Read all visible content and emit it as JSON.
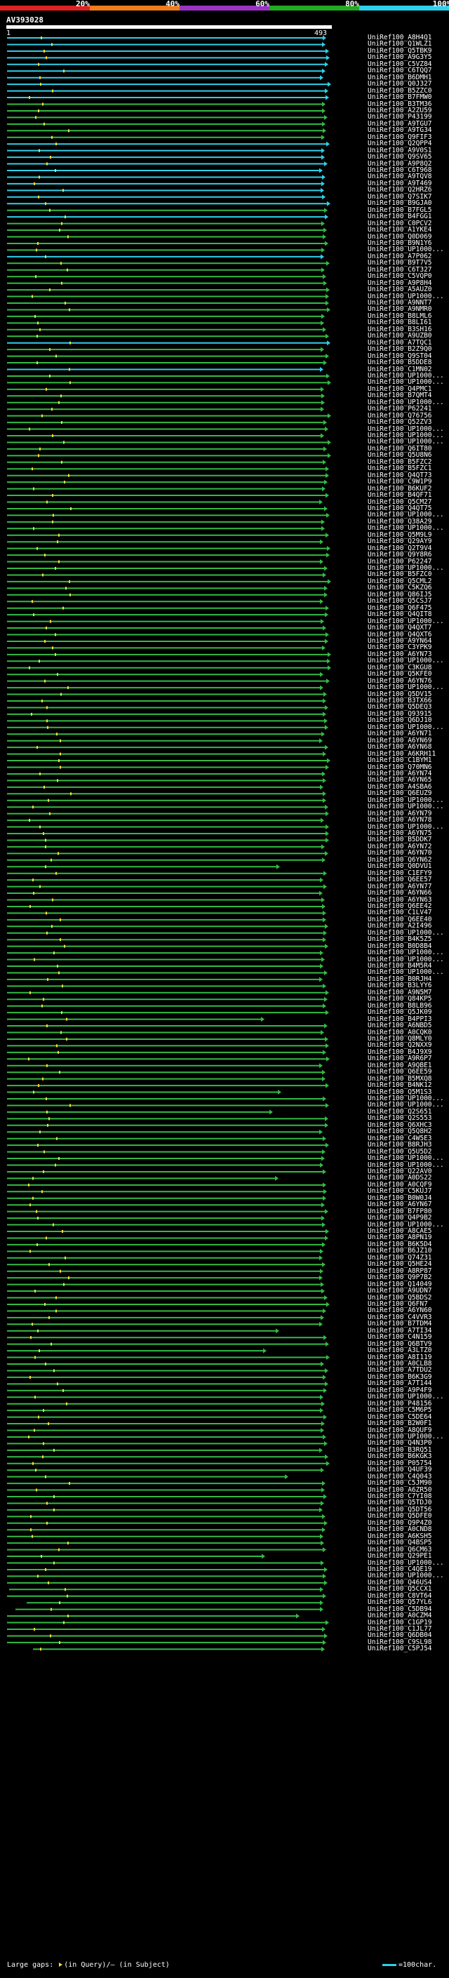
{
  "query": {
    "id": "AV393028",
    "start": "1",
    "end": "493"
  },
  "identity_scale": [
    {
      "label": "20%",
      "color": "#dd2222"
    },
    {
      "label": "40%",
      "color": "#f07c1c"
    },
    {
      "label": "60%",
      "color": "#9b34c4"
    },
    {
      "label": "80%",
      "color": "#22aa22"
    },
    {
      "label": "100%",
      "color": "#2ed0ea"
    }
  ],
  "legend": {
    "text": "Large gaps: ",
    "in_query": "(in Query)",
    "in_subject": "/— (in Subject)",
    "scale": "=100char."
  },
  "hit_colors": {
    "high": "#2ed0ea",
    "mid": "#33bb44",
    "low": "#1e7a2a"
  },
  "hits": [
    "UniRef100_A8H4Q1",
    "UniRef100_Q1WLZ1",
    "UniRef100_Q5TBK9",
    "UniRef100_A9G3Y5",
    "UniRef100_C5VZ84",
    "UniRef100_C6TQQ7",
    "UniRef100_B6DMH1",
    "UniRef100_Q0J327",
    "UniRef100_B5ZZC0",
    "UniRef100_B7FMW0",
    "UniRef100_B3TM36",
    "UniRef100_A2ZU59",
    "UniRef100_P43199",
    "UniRef100_A9TGU7",
    "UniRef100_A9TG34",
    "UniRef100_Q9FIF3",
    "UniRef100_Q2QPP4",
    "UniRef100_A9V0S1",
    "UniRef100_Q9SV65",
    "UniRef100_A9P8Q2",
    "UniRef100_C6T968",
    "UniRef100_A9TQV8",
    "UniRef100_A9T469",
    "UniRef100_Q2HRZ6",
    "UniRef100_Q7SIK7",
    "UniRef100_B9GJA0",
    "UniRef100_B7FGL5",
    "UniRef100_B4FGG1",
    "UniRef100_C0PCV2",
    "UniRef100_A1YKE4",
    "UniRef100_Q0D069",
    "UniRef100_B9N1Y6",
    "UniRef100_UP1000...",
    "UniRef100_A7P062",
    "UniRef100_B9T7V5",
    "UniRef100_C6T327",
    "UniRef100_C5VQP0",
    "UniRef100_A9P8H4",
    "UniRef100_A5AUZ0",
    "UniRef100_UP1000...",
    "UniRef100_A9NNT7",
    "UniRef100_A9NMR0",
    "UniRef100_B8LML6",
    "UniRef100_B8LI61",
    "UniRef100_B3SH16",
    "UniRef100_A9UZB0",
    "UniRef100_A7TQC1",
    "UniRef100_B2Z9Q0",
    "UniRef100_Q9ST04",
    "UniRef100_B5DDE8",
    "UniRef100_C1MN02",
    "UniRef100_UP1000...",
    "UniRef100_UP1000...",
    "UniRef100_Q4PMC1",
    "UniRef100_B7QMT4",
    "UniRef100_UP1000...",
    "UniRef100_P62241",
    "UniRef100_Q76756",
    "UniRef100_Q52ZV3",
    "UniRef100_UP1000...",
    "UniRef100_UP1000...",
    "UniRef100_UP1000...",
    "UniRef100_Q6IT80",
    "UniRef100_Q5U8N6",
    "UniRef100_B5FZC2",
    "UniRef100_B5FZC1",
    "UniRef100_Q4QT73",
    "UniRef100_C9W1P9",
    "UniRef100_B6KUF2",
    "UniRef100_B4QF71",
    "UniRef100_Q5CM27",
    "UniRef100_Q4QT75",
    "UniRef100_UP1000...",
    "UniRef100_Q38A29",
    "UniRef100_UP1000...",
    "UniRef100_Q5M9L9",
    "UniRef100_Q29AY9",
    "UniRef100_Q2T9V4",
    "UniRef100_Q9Y8R6",
    "UniRef100_P62247",
    "UniRef100_UP1000...",
    "UniRef100_B5FZC0",
    "UniRef100_Q5CML2",
    "UniRef100_C5KZQ6",
    "UniRef100_Q86IJ5",
    "UniRef100_Q5CSJ7",
    "UniRef100_Q6F475",
    "UniRef100_Q4QIT8",
    "UniRef100_UP1000...",
    "UniRef100_Q4QXT7",
    "UniRef100_Q4QXT6",
    "UniRef100_A9YN64",
    "UniRef100_C3YPK9",
    "UniRef100_A6YN73",
    "UniRef100_UP1000...",
    "UniRef100_C3KGU8",
    "UniRef100_Q5KFE0",
    "UniRef100_A6YN76",
    "UniRef100_UP1000...",
    "UniRef100_Q5DV15",
    "UniRef100_B3TX66",
    "UniRef100_Q5DEQ3",
    "UniRef100_Q93915",
    "UniRef100_Q6DJ10",
    "UniRef100_UP1000...",
    "UniRef100_A6YN71",
    "UniRef100_A6YN69",
    "UniRef100_A6YN68",
    "UniRef100_A6KRH11",
    "UniRef100_C1BYM1",
    "UniRef100_Q70MN6",
    "UniRef100_A6YN74",
    "UniRef100_A6YN65",
    "UniRef100_A4SBA6",
    "UniRef100_Q6EUZ9",
    "UniRef100_UP1000...",
    "UniRef100_UP1000...",
    "UniRef100_A6YN79",
    "UniRef100_A6YN78",
    "UniRef100_UP1000...",
    "UniRef100_A6YN75",
    "UniRef100_B5DDK7",
    "UniRef100_A6YN72",
    "UniRef100_A6YN70",
    "UniRef100_Q6YN62",
    "UniRef100_Q0DVU1",
    "UniRef100_C1EFY9",
    "UniRef100_Q6EE57",
    "UniRef100_A6YN77",
    "UniRef100_A6YN66",
    "UniRef100_A6YN63",
    "UniRef100_Q6EE42",
    "UniRef100_C1LV47",
    "UniRef100_Q6EE40",
    "UniRef100_A2I496",
    "UniRef100_UP1000...",
    "UniRef100_B4K5Z5",
    "UniRef100_B0D8B4",
    "UniRef100_UP1000...",
    "UniRef100_UP1000...",
    "UniRef100_B4M5R4",
    "UniRef100_UP1000...",
    "UniRef100_B0RJH4",
    "UniRef100_B3LYY6",
    "UniRef100_A9N5M7",
    "UniRef100_Q84KP5",
    "UniRef100_B8LB96",
    "UniRef100_Q5JK09",
    "UniRef100_B4PPI3",
    "UniRef100_A6NBD5",
    "UniRef100_A0CQK0",
    "UniRef100_Q8MLY0",
    "UniRef100_Q2NXX9",
    "UniRef100_B4J9X9",
    "UniRef100_A9R6P7",
    "UniRef100_A9QBE1",
    "UniRef100_Q6EE59",
    "UniRef100_B5MXQ8",
    "UniRef100_B4NK12",
    "UniRef100_Q5M1S3",
    "UniRef100_UP1000...",
    "UniRef100_UP1000...",
    "UniRef100_Q2S651",
    "UniRef100_Q2S553",
    "UniRef100_Q6XHC3",
    "UniRef100_Q5Q8H2",
    "UniRef100_C4W5E3",
    "UniRef100_B8RJH3",
    "UniRef100_Q5U5D2",
    "UniRef100_UP1000...",
    "UniRef100_UP1000...",
    "UniRef100_Q22AV0",
    "UniRef100_A0DS22",
    "UniRef100_A0CQF9",
    "UniRef100_C5KUJ7",
    "UniRef100_B0W0J4",
    "UniRef100_A6YN67",
    "UniRef100_B7FP80",
    "UniRef100_Q4P9B2",
    "UniRef100_UP1000...",
    "UniRef100_A8CAE5",
    "UniRef100_A8PN19",
    "UniRef100_B6K5D4",
    "UniRef100_B6JZ10",
    "UniRef100_Q74Z31",
    "UniRef100_Q5HE24",
    "UniRef100_A8RP87",
    "UniRef100_Q9P7B2",
    "UniRef100_Q14049",
    "UniRef100_A9UDN7",
    "UniRef100_Q5BDS2",
    "UniRef100_Q6FN7",
    "UniRef100_A6YN60",
    "UniRef100_C4VVR3",
    "UniRef100_B7TDM4",
    "UniRef100_A7TI34",
    "UniRef100_C4N159",
    "UniRef100_Q6BTV9",
    "UniRef100_A3LTZ0",
    "UniRef100_A8I119",
    "UniRef100_A0CLB8",
    "UniRef100_A7TDU2",
    "UniRef100_B6K3G9",
    "UniRef100_A7T144",
    "UniRef100_A9P4F9",
    "UniRef100_UP1000...",
    "UniRef100_P48156",
    "UniRef100_C5M6P5",
    "UniRef100_C5DE64",
    "UniRef100_B2W0F1",
    "UniRef100_A8QUF9",
    "UniRef100_UP1000...",
    "UniRef100_Q4N3P0",
    "UniRef100_B3RQ51",
    "UniRef100_B6KGK3",
    "UniRef100_P05754",
    "UniRef100_Q4UF39",
    "UniRef100_C4Q043",
    "UniRef100_C5JM90",
    "UniRef100_A6ZR50",
    "UniRef100_C7YI08",
    "UniRef100_Q5TDJ0",
    "UniRef100_Q5DT56",
    "UniRef100_Q5DFE0",
    "UniRef100_Q9P4Z0",
    "UniRef100_A0CND8",
    "UniRef100_A6KSH5",
    "UniRef100_Q4BSP5",
    "UniRef100_Q6CM63",
    "UniRef100_Q29PE1",
    "UniRef100_UP1000...",
    "UniRef100_C4QE19",
    "UniRef100_UP1000...",
    "UniRef100_Q46US4",
    "UniRef100_Q5CCX1",
    "UniRef100_C8VT64",
    "UniRef100_Q57YL6",
    "UniRef100_C5DB94",
    "UniRef100_A0CZM4",
    "UniRef100_C1GP19",
    "UniRef100_C1JL77",
    "UniRef100_Q6DB04",
    "UniRef100_C9SL98",
    "UniRef100_C5PJ54"
  ]
}
